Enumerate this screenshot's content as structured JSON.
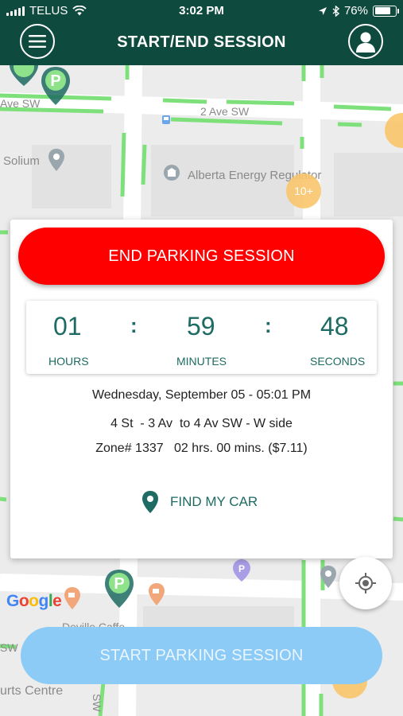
{
  "status_bar": {
    "carrier": "TELUS",
    "time": "3:02 PM",
    "battery": "76%",
    "battery_level": 0.76
  },
  "header": {
    "title": "START/END SESSION",
    "menu_icon": "hamburger-icon",
    "profile_icon": "user-icon"
  },
  "map": {
    "labels": {
      "street_a": "Ave SW",
      "street_b": "2 Ave SW",
      "poi_solium": "Solium",
      "poi_alberta": "Alberta Energy Regulator",
      "cluster": "10+",
      "google": "Google",
      "cafe": "Deville Caffe",
      "centre": "urts Centre",
      "sw_left": "SW",
      "sw_bottom": "SW"
    }
  },
  "session": {
    "end_button": "END PARKING SESSION",
    "timer": {
      "hours": "01",
      "hours_label": "HOURS",
      "minutes": "59",
      "minutes_label": "MINUTES",
      "seconds": "48",
      "seconds_label": "SECONDS",
      "separator": ":"
    },
    "start_time": "Wednesday, September 05 - 05:01 PM",
    "location": "4 St  - 3 Av  to 4 Av SW - W side",
    "zone": "Zone# 1337   02 hrs. 00 mins. ($7.11)",
    "find_car": "FIND MY CAR"
  },
  "start_button": "START PARKING SESSION",
  "colors": {
    "header": "#0f4a3e",
    "end_button": "#ff0000",
    "start_button": "#8ccbf6",
    "accent_text": "#1d6b62",
    "parking_line": "#7ee07a",
    "cluster": "#f9c66c"
  }
}
